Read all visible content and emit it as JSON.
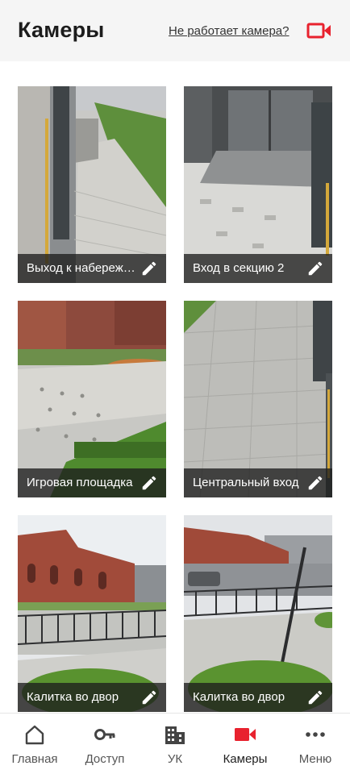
{
  "header": {
    "title": "Камеры",
    "report_link": "Не работает камера?",
    "icon": "video-camera-icon"
  },
  "colors": {
    "accent": "#e8222e",
    "header_bg": "#f5f5f5",
    "caption_bg": "#1e1e1e"
  },
  "cameras": [
    {
      "label": "Выход к набережной",
      "icon": "edit-icon"
    },
    {
      "label": "Вход в секцию 2",
      "icon": "edit-icon"
    },
    {
      "label": "Игровая площадка",
      "icon": "edit-icon"
    },
    {
      "label": "Центральный вход",
      "icon": "edit-icon"
    },
    {
      "label": "Калитка во двор",
      "icon": "edit-icon"
    },
    {
      "label": "Калитка во двор",
      "icon": "edit-icon"
    }
  ],
  "tabbar": {
    "items": [
      {
        "label": "Главная",
        "icon": "home-icon"
      },
      {
        "label": "Доступ",
        "icon": "key-icon"
      },
      {
        "label": "УК",
        "icon": "building-icon"
      },
      {
        "label": "Камеры",
        "icon": "video-camera-icon",
        "active": true
      },
      {
        "label": "Меню",
        "icon": "more-dots-icon"
      }
    ]
  }
}
